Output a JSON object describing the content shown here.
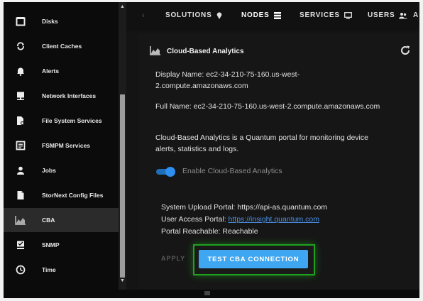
{
  "sidebar": {
    "items": [
      {
        "label": "Disks",
        "icon": "disk-icon"
      },
      {
        "label": "Client Caches",
        "icon": "sync-icon"
      },
      {
        "label": "Alerts",
        "icon": "bell-icon"
      },
      {
        "label": "Network Interfaces",
        "icon": "monitor-icon"
      },
      {
        "label": "File System Services",
        "icon": "file-gear-icon"
      },
      {
        "label": "FSMPM Services",
        "icon": "list-icon"
      },
      {
        "label": "Jobs",
        "icon": "person-icon"
      },
      {
        "label": "StorNext Config Files",
        "icon": "document-icon"
      },
      {
        "label": "CBA",
        "icon": "area-chart-icon",
        "active": true
      },
      {
        "label": "SNMP",
        "icon": "snmp-icon"
      },
      {
        "label": "Time",
        "icon": "clock-icon"
      }
    ]
  },
  "topnav": {
    "items": [
      {
        "label": "SOLUTIONS",
        "icon": "location-pin-icon"
      },
      {
        "label": "NODES",
        "icon": "server-icon",
        "active": true
      },
      {
        "label": "SERVICES",
        "icon": "screen-icon"
      },
      {
        "label": "USERS",
        "icon": "users-icon"
      },
      {
        "label": "A",
        "icon": ""
      }
    ]
  },
  "panel": {
    "title": "Cloud-Based Analytics",
    "display_name_line1": "Display Name: ec2-34-210-75-160.us-west-",
    "display_name_line2": "2.compute.amazonaws.com",
    "full_name": "Full Name: ec2-34-210-75-160.us-west-2.compute.amazonaws.com",
    "description_line1": "Cloud-Based Analytics is a Quantum portal for monitoring device",
    "description_line2": "alerts, statistics and logs.",
    "toggle_label": "Enable Cloud-Based Analytics",
    "toggle_enabled": true,
    "upload_portal_label": "System Upload Portal:",
    "upload_portal_value": "https://api-as.quantum.com",
    "user_portal_label": "User Access Portal:",
    "user_portal_value": "https://insight.quantum.com",
    "reachable_label": "Portal Reachable:",
    "reachable_value": "Reachable",
    "apply_label": "APPLY",
    "test_button_label": "TEST CBA CONNECTION"
  },
  "colors": {
    "accent": "#3fa6f2",
    "highlight": "#1fa31f",
    "link": "#4a8fe0"
  }
}
